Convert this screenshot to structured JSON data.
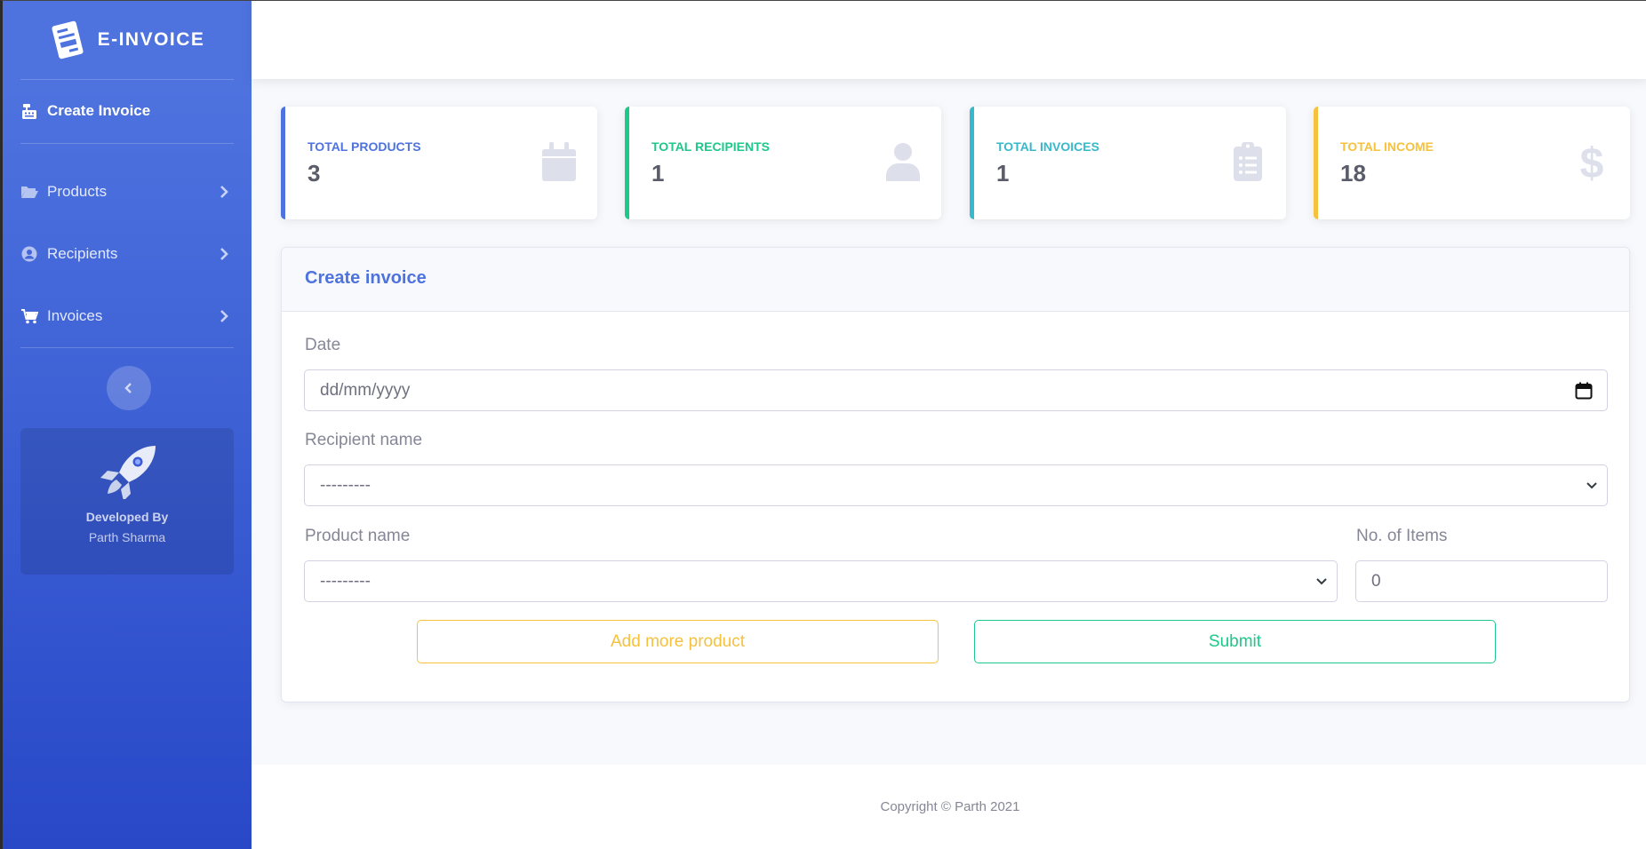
{
  "brand": {
    "name": "E-INVOICE"
  },
  "sidebar": {
    "active_item": "Create Invoice",
    "items": [
      {
        "label": "Products",
        "icon": "folder-open-icon"
      },
      {
        "label": "Recipients",
        "icon": "user-circle-icon"
      },
      {
        "label": "Invoices",
        "icon": "shopping-cart-icon"
      }
    ],
    "promo": {
      "title": "Developed By",
      "subtitle": "Parth Sharma"
    }
  },
  "stats": [
    {
      "label": "TOTAL PRODUCTS",
      "value": "3",
      "color": "#4e73df",
      "icon": "calendar-icon"
    },
    {
      "label": "TOTAL RECIPIENTS",
      "value": "1",
      "color": "#1cc88a",
      "icon": "user-icon"
    },
    {
      "label": "TOTAL INVOICES",
      "value": "1",
      "color": "#36b9cc",
      "icon": "clipboard-list-icon"
    },
    {
      "label": "TOTAL INCOME",
      "value": "18",
      "color": "#f6c23e",
      "icon": "dollar-icon"
    }
  ],
  "form": {
    "title": "Create invoice",
    "date_label": "Date",
    "date_placeholder": "dd/mm/yyyy",
    "recipient_label": "Recipient name",
    "recipient_value": "---------",
    "product_label": "Product name",
    "product_value": "---------",
    "items_label": "No. of Items",
    "items_value": "0",
    "add_button": "Add more product",
    "submit_button": "Submit"
  },
  "footer": {
    "copyright": "Copyright © Parth 2021"
  },
  "colors": {
    "primary": "#4e73df",
    "success": "#1cc88a",
    "info": "#36b9cc",
    "warning": "#f6c23e"
  }
}
